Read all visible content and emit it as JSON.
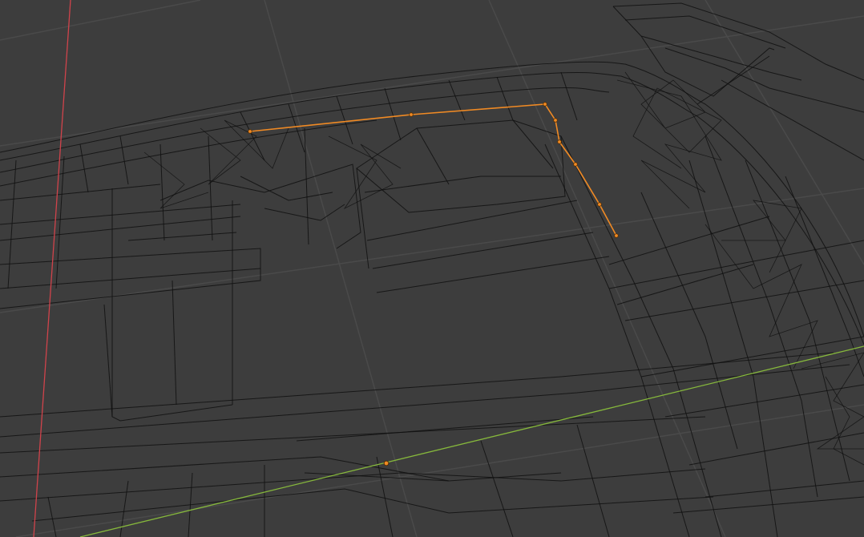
{
  "viewport": {
    "mode": "edit-mode-wireframe",
    "background_color": "#3d3d3d",
    "grid_color": "#4a4a4a",
    "wire_color": "#111111",
    "x_axis_color": "#d0434b",
    "y_axis_color": "#86b83c",
    "selection_color": "#f08a24",
    "selected_vertex_count": 8,
    "selected_edge_count": 7,
    "object_origin_icon": "origin-dot-icon"
  }
}
